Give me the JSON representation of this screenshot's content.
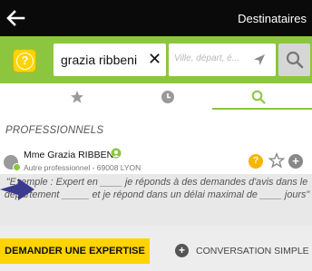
{
  "header": {
    "title": "Destinataires",
    "back_icon": "arrow-left-icon"
  },
  "search": {
    "help_glyph": "?",
    "name_value": "grazia ribbeni",
    "clear_glyph": "✕",
    "location_placeholder": "Ville, départ, é...",
    "location_icon": "location-arrow-icon",
    "search_icon": "search-icon"
  },
  "tabs": [
    {
      "icon": "star-icon"
    },
    {
      "icon": "clock-icon"
    },
    {
      "icon": "search-icon",
      "active": true
    }
  ],
  "section": {
    "title": "PROFESSIONNELS"
  },
  "result": {
    "name": "Mme Grazia RIBBENI",
    "subtitle": "Autre professionnel - 69008 LYON",
    "help_glyph": "?",
    "add_glyph": "+"
  },
  "tooltip": {
    "text": "\"Exemple : Expert en ____ je réponds à des demandes d'avis dans le département _____ et je répond dans un délai maximal de ____ jours\""
  },
  "actions": {
    "expert_label": "DEMANDER UNE EXPERTISE",
    "conversation_label": "CONVERSATION SIMPLE",
    "conversation_glyph": "+"
  },
  "colors": {
    "accent_green": "#8cc63f",
    "accent_yellow": "#ffd400",
    "topbar": "#0a0a0a",
    "pointer_arrow": "#3b3b8f"
  }
}
